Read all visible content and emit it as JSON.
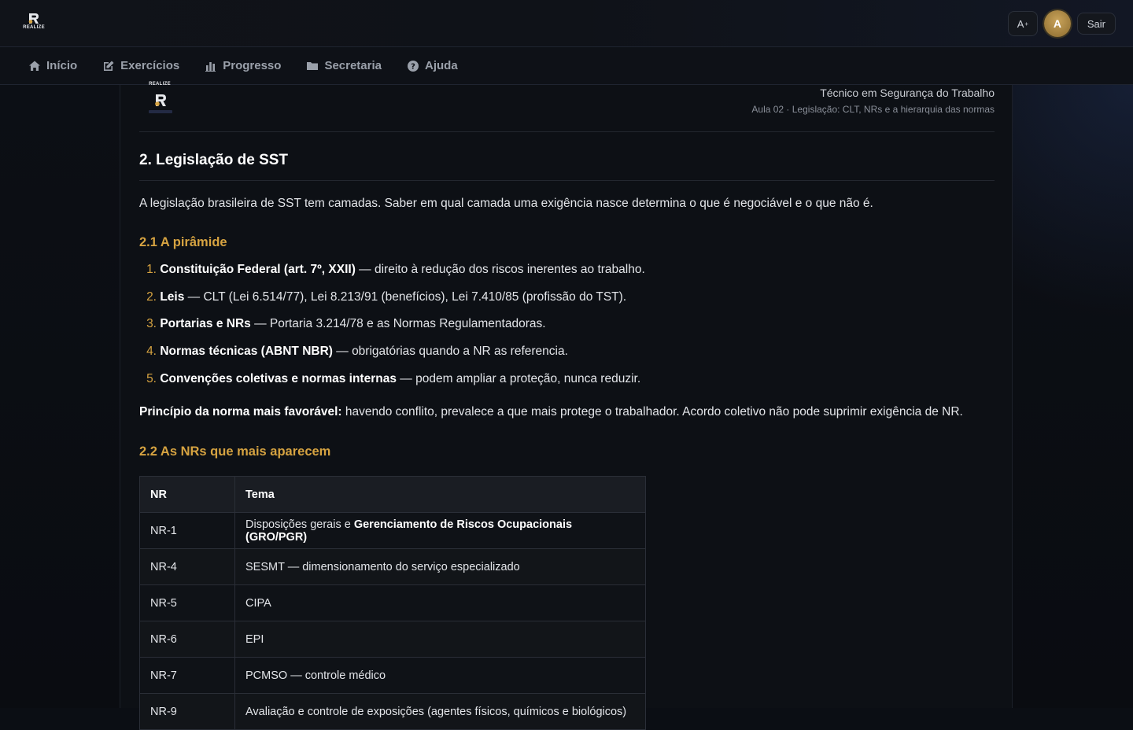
{
  "app": {
    "logo_text": "REALIZE"
  },
  "topbar": {
    "font_button": "A",
    "font_button_sup": "+",
    "avatar_initial": "A",
    "logout_label": "Sair"
  },
  "nav": {
    "items": [
      {
        "label": "Início",
        "icon": "home-icon"
      },
      {
        "label": "Exercícios",
        "icon": "edit-icon"
      },
      {
        "label": "Progresso",
        "icon": "bar-chart-icon"
      },
      {
        "label": "Secretaria",
        "icon": "folder-icon"
      },
      {
        "label": "Ajuda",
        "icon": "question-circle-icon"
      }
    ]
  },
  "doc": {
    "logo_text": "REALIZE",
    "course": "Técnico em Segurança do Trabalho",
    "lesson": "Aula 02 · Legislação: CLT, NRs e a hierarquia das normas",
    "section_title": "2. Legislação de SST",
    "intro": "A legislação brasileira de SST tem camadas. Saber em qual camada uma exigência nasce determina o que é negociável e o que não é.",
    "sub1_title": "2.1 A pirâmide",
    "pyramid": [
      {
        "num": "1.",
        "bold": "Constituição Federal (art. 7º, XXII)",
        "text": " — direito à redução dos riscos inerentes ao trabalho."
      },
      {
        "num": "2.",
        "bold": "Leis",
        "text": " — CLT (Lei 6.514/77), Lei 8.213/91 (benefícios), Lei 7.410/85 (profissão do TST)."
      },
      {
        "num": "3.",
        "bold": "Portarias e NRs",
        "text": " — Portaria 3.214/78 e as Normas Regulamentadoras."
      },
      {
        "num": "4.",
        "bold": "Normas técnicas (ABNT NBR)",
        "text": " — obrigatórias quando a NR as referencia."
      },
      {
        "num": "5.",
        "bold": "Convenções coletivas e normas internas",
        "text": " — podem ampliar a proteção, nunca reduzir."
      }
    ],
    "principle_bold": "Princípio da norma mais favorável:",
    "principle_text": " havendo conflito, prevalece a que mais protege o trabalhador. Acordo coletivo não pode suprimir exigência de NR.",
    "sub2_title": "2.2 As NRs que mais aparecem",
    "table": {
      "headers": [
        "NR",
        "Tema"
      ],
      "rows": [
        {
          "nr": "NR-1",
          "tema": "Disposições gerais e ",
          "tema_bold": "Gerenciamento de Riscos Ocupacionais (GRO/PGR)"
        },
        {
          "nr": "NR-4",
          "tema": "SESMT — dimensionamento do serviço especializado",
          "tema_bold": ""
        },
        {
          "nr": "NR-5",
          "tema": "CIPA",
          "tema_bold": ""
        },
        {
          "nr": "NR-6",
          "tema": "EPI",
          "tema_bold": ""
        },
        {
          "nr": "NR-7",
          "tema": "PCMSO — controle médico",
          "tema_bold": ""
        },
        {
          "nr": "NR-9",
          "tema": "Avaliação e controle de exposições (agentes físicos, químicos e biológicos)",
          "tema_bold": ""
        }
      ]
    }
  },
  "colors": {
    "accent": "#d6a341",
    "background": "#0b0e14",
    "panel": "#0d1015"
  }
}
